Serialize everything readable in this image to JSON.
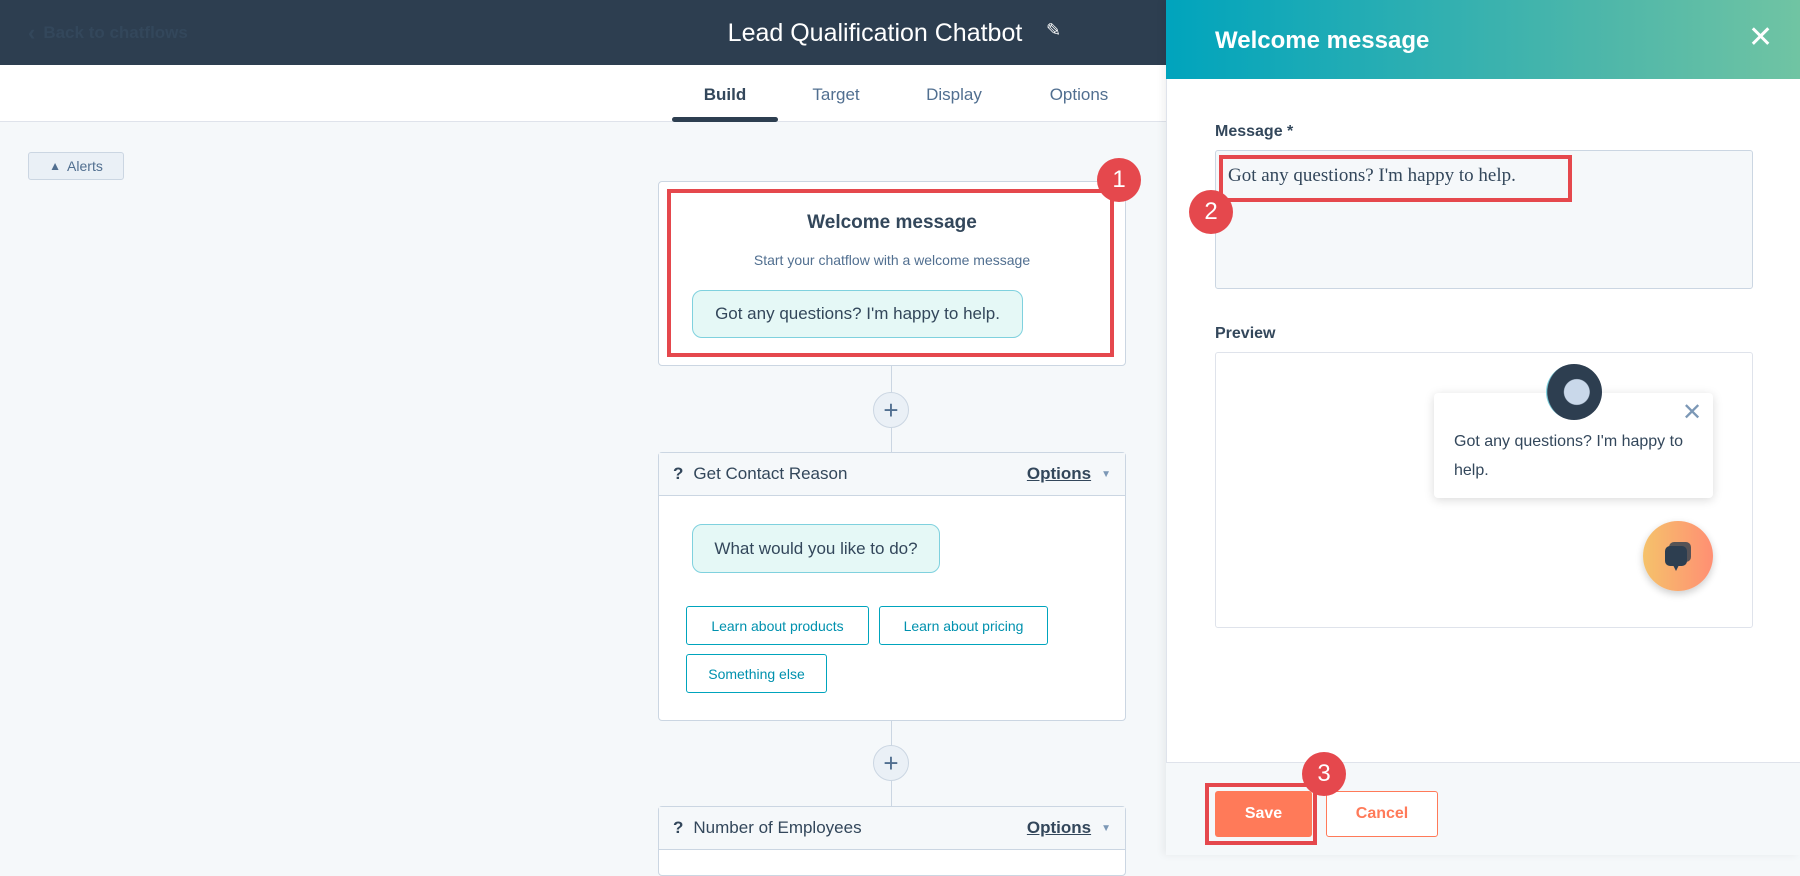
{
  "header": {
    "back_label": "Back to chatflows",
    "title": "Lead Qualification Chatbot"
  },
  "tabs": [
    {
      "label": "Build",
      "active": true
    },
    {
      "label": "Target"
    },
    {
      "label": "Display"
    },
    {
      "label": "Options"
    }
  ],
  "alerts_label": "Alerts",
  "welcome_card": {
    "title": "Welcome message",
    "subtitle": "Start your chatflow with a welcome message",
    "message": "Got any questions? I'm happy to help."
  },
  "contact_card": {
    "qmark": "?",
    "title": "Get Contact Reason",
    "options_label": "Options",
    "question": "What would you like to do?",
    "choices": [
      "Learn about products",
      "Learn about pricing",
      "Something else"
    ]
  },
  "employees_card": {
    "qmark": "?",
    "title": "Number of Employees",
    "options_label": "Options"
  },
  "panel": {
    "title": "Welcome message",
    "message_label": "Message *",
    "message_value": "Got any questions? I'm happy to help.",
    "preview_label": "Preview",
    "preview_text": "Got any questions? I'm happy to help.",
    "save_label": "Save",
    "cancel_label": "Cancel"
  },
  "badges": [
    "1",
    "2",
    "3"
  ],
  "colors": {
    "header": "#2d3e50",
    "accent": "#ff7a59",
    "teal": "#00a4bd",
    "annotation": "#e5484d"
  }
}
